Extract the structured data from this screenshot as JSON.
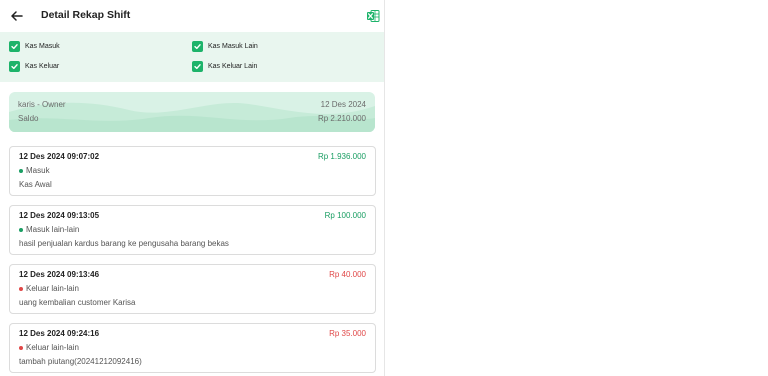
{
  "header": {
    "title": "Detail Rekap Shift",
    "back_icon": "arrow-left-icon",
    "export_icon": "excel-icon"
  },
  "filters": [
    {
      "label": "Kas Masuk",
      "checked": true
    },
    {
      "label": "Kas Masuk Lain",
      "checked": true
    },
    {
      "label": "Kas Keluar",
      "checked": true
    },
    {
      "label": "Kas Keluar Lain",
      "checked": true
    }
  ],
  "summary": {
    "user": "karis - Owner",
    "date": "12 Des 2024",
    "saldo_label": "Saldo",
    "saldo_value": "Rp 2.210.000"
  },
  "transactions": [
    {
      "datetime": "12 Des 2024 09:07:02",
      "amount": "Rp 1.936.000",
      "type": "Masuk",
      "note": "Kas Awal",
      "direction": "in"
    },
    {
      "datetime": "12 Des 2024 09:13:05",
      "amount": "Rp 100.000",
      "type": "Masuk lain-lain",
      "note": "hasil penjualan kardus barang ke pengusaha barang bekas",
      "direction": "in"
    },
    {
      "datetime": "12 Des 2024 09:13:46",
      "amount": "Rp 40.000",
      "type": "Keluar lain-lain",
      "note": "uang kembalian customer Karisa",
      "direction": "out"
    },
    {
      "datetime": "12 Des 2024 09:24:16",
      "amount": "Rp 35.000",
      "type": "Keluar lain-lain",
      "note": "tambah piutang(20241212092416)",
      "direction": "out"
    }
  ],
  "colors": {
    "accent": "#1db36a",
    "income": "#1a9e63",
    "expense": "#e04848",
    "filter_bg": "#e9f6ef",
    "summary_bg": "#d9f2e6"
  }
}
